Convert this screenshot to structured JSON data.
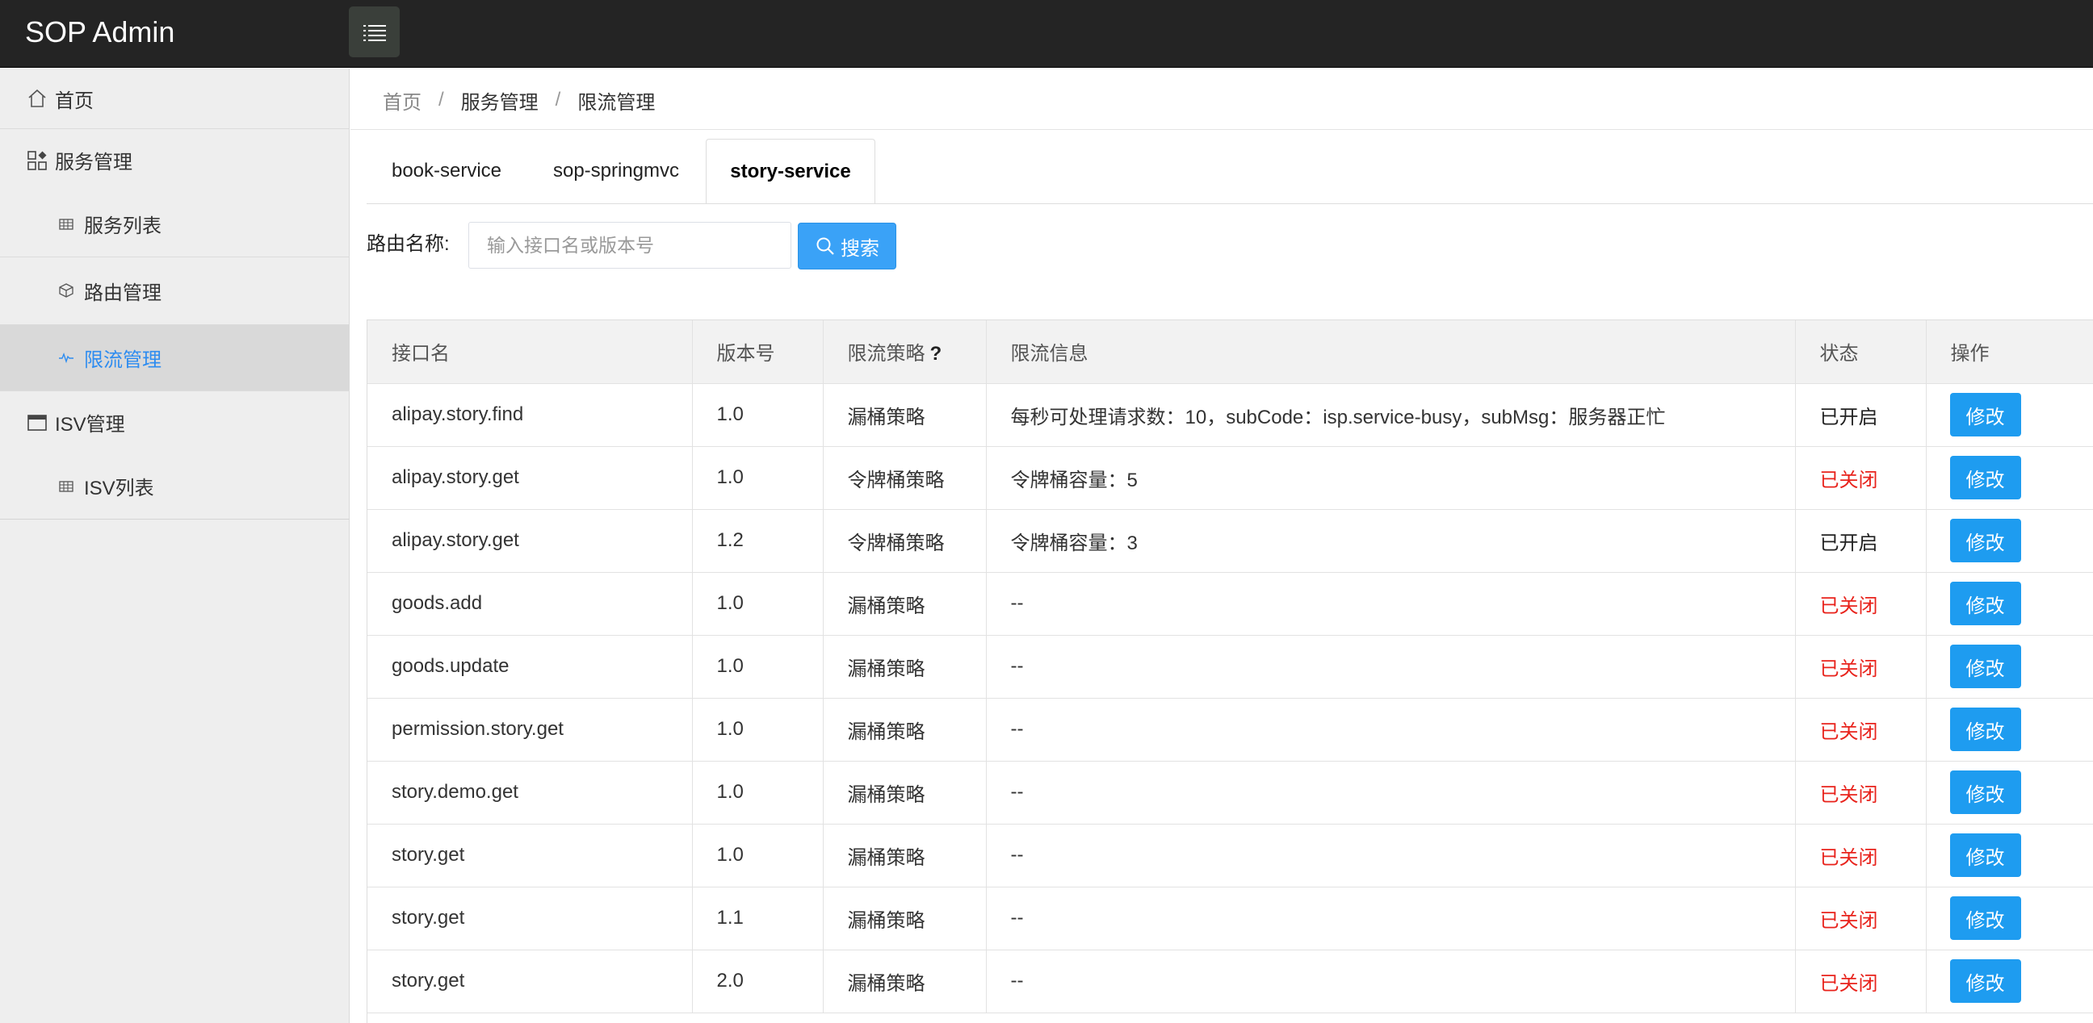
{
  "app": {
    "title": "SOP Admin"
  },
  "sidebar": {
    "items": [
      {
        "label": "首页",
        "icon": "home-icon"
      },
      {
        "label": "服务管理",
        "icon": "apps-icon"
      },
      {
        "label": "服务列表",
        "icon": "grid-icon"
      },
      {
        "label": "路由管理",
        "icon": "cube-icon"
      },
      {
        "label": "限流管理",
        "icon": "pulse-icon",
        "active": true
      },
      {
        "label": "ISV管理",
        "icon": "window-icon"
      },
      {
        "label": "ISV列表",
        "icon": "grid-icon"
      }
    ]
  },
  "breadcrumb": {
    "items": [
      "首页",
      "服务管理",
      "限流管理"
    ],
    "separator": "/"
  },
  "tabs": [
    {
      "label": "book-service"
    },
    {
      "label": "sop-springmvc"
    },
    {
      "label": "story-service",
      "active": true
    }
  ],
  "search": {
    "label": "路由名称:",
    "placeholder": "输入接口名或版本号",
    "value": "",
    "button": "搜索"
  },
  "table": {
    "columns": [
      "接口名",
      "版本号",
      "限流策略",
      "限流信息",
      "状态",
      "操作"
    ],
    "help_mark": "?",
    "rows": [
      {
        "name": "alipay.story.find",
        "version": "1.0",
        "strategy": "漏桶策略",
        "info": "每秒可处理请求数：10，subCode：isp.service-busy，subMsg：服务器正忙",
        "status": "已开启",
        "on": true,
        "action": "修改"
      },
      {
        "name": "alipay.story.get",
        "version": "1.0",
        "strategy": "令牌桶策略",
        "info": "令牌桶容量：5",
        "status": "已关闭",
        "on": false,
        "action": "修改"
      },
      {
        "name": "alipay.story.get",
        "version": "1.2",
        "strategy": "令牌桶策略",
        "info": "令牌桶容量：3",
        "status": "已开启",
        "on": true,
        "action": "修改"
      },
      {
        "name": "goods.add",
        "version": "1.0",
        "strategy": "漏桶策略",
        "info": "--",
        "status": "已关闭",
        "on": false,
        "action": "修改"
      },
      {
        "name": "goods.update",
        "version": "1.0",
        "strategy": "漏桶策略",
        "info": "--",
        "status": "已关闭",
        "on": false,
        "action": "修改"
      },
      {
        "name": "permission.story.get",
        "version": "1.0",
        "strategy": "漏桶策略",
        "info": "--",
        "status": "已关闭",
        "on": false,
        "action": "修改"
      },
      {
        "name": "story.demo.get",
        "version": "1.0",
        "strategy": "漏桶策略",
        "info": "--",
        "status": "已关闭",
        "on": false,
        "action": "修改"
      },
      {
        "name": "story.get",
        "version": "1.0",
        "strategy": "漏桶策略",
        "info": "--",
        "status": "已关闭",
        "on": false,
        "action": "修改"
      },
      {
        "name": "story.get",
        "version": "1.1",
        "strategy": "漏桶策略",
        "info": "--",
        "status": "已关闭",
        "on": false,
        "action": "修改"
      },
      {
        "name": "story.get",
        "version": "2.0",
        "strategy": "漏桶策略",
        "info": "--",
        "status": "已关闭",
        "on": false,
        "action": "修改"
      }
    ]
  },
  "colors": {
    "header_bg": "#242424",
    "sidebar_bg": "#eeeeee",
    "accent": "#2d8cf0",
    "button": "#1e9cf0",
    "status_off": "#e8231c"
  }
}
